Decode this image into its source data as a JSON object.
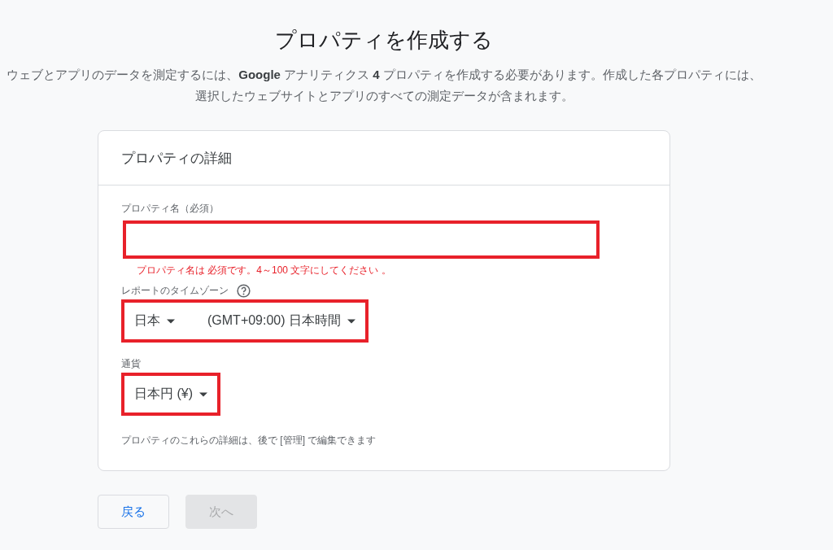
{
  "title": "プロパティを作成する",
  "description": "ウェブとアプリのデータを測定するには、**Google** アナリティクス **4** プロパティを作成する必要があります。作成した各プロパティには、選択したウェブサイトとアプリのすべての測定データが含まれます。",
  "card": {
    "heading": "プロパティの詳細",
    "property_name": {
      "label": "プロパティ名（必須）",
      "highlighted": true,
      "error": "プロパティ名は 必須です。4～100 文字にしてください 。"
    },
    "timezone": {
      "label": "レポートのタイムゾーン",
      "highlighted": true,
      "dropdowns": [
        {
          "value": "日本"
        },
        {
          "value": "(GMT+09:00) 日本時間"
        }
      ]
    },
    "currency": {
      "label": "通貨",
      "highlighted": true,
      "dropdowns": [
        {
          "value": "日本円 (¥)"
        }
      ]
    },
    "note": "プロパティのこれらの詳細は、後で [管理] で編集できます"
  },
  "buttons": [
    {
      "label": "戻る",
      "disabled": false
    },
    {
      "label": "次へ",
      "disabled": true
    }
  ]
}
